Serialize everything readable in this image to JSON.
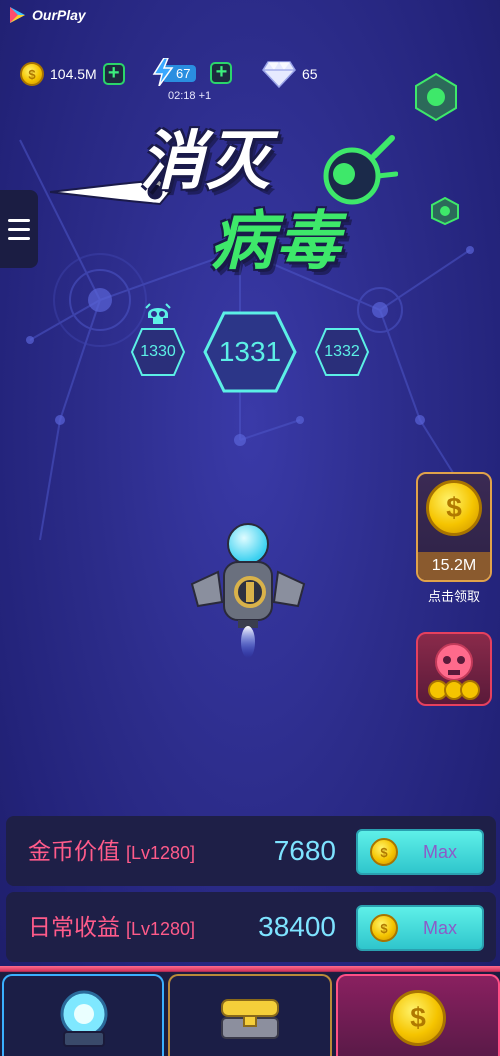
{
  "app": {
    "brand": "OurPlay"
  },
  "resources": {
    "coins": "104.5M",
    "coin_icon": "gold-coin-icon",
    "energy": "67",
    "energy_timer": "02:18 +1",
    "energy_icon": "lightning-icon",
    "gems": "65",
    "gem_icon": "diamond-icon"
  },
  "title": {
    "line1": "消灭",
    "line2": "病毒"
  },
  "levels": {
    "prev": "1330",
    "current": "1331",
    "next": "1332",
    "boss_icon": "skull-icon"
  },
  "side": {
    "reward_amount": "15.2M",
    "reward_caption": "点击领取",
    "virus_icon": "virus-skull-coins-icon"
  },
  "upgrades": [
    {
      "name": "金币价值",
      "level": "[Lv1280]",
      "value": "7680",
      "button": "Max"
    },
    {
      "name": "日常收益",
      "level": "[Lv1280]",
      "value": "38400",
      "button": "Max"
    }
  ],
  "tabs": [
    {
      "icon": "tower-orb-icon"
    },
    {
      "icon": "treasure-chest-icon"
    },
    {
      "icon": "gold-coin-icon"
    }
  ],
  "colors": {
    "accent_green": "#3ee86a",
    "accent_cyan": "#5ef0e8",
    "accent_pink": "#ff5b8a",
    "level_teal": "#5cf0e6"
  }
}
